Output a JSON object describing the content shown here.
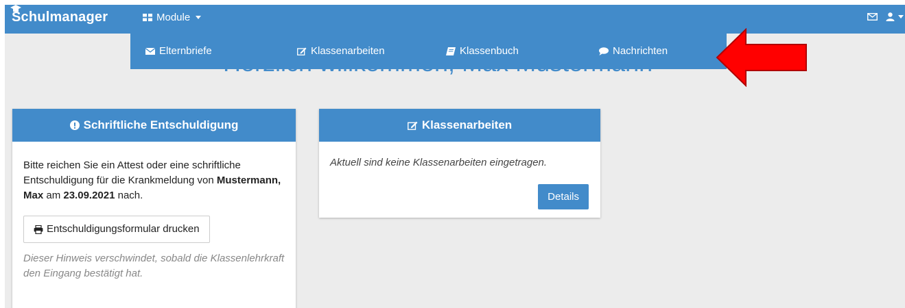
{
  "app": {
    "brand": "Schulmanager"
  },
  "navbar": {
    "module_label": "Module",
    "icons": {
      "module": "grid-icon",
      "mail": "envelope-icon",
      "user": "user-icon"
    }
  },
  "dropdown": {
    "items": [
      {
        "label": "Elternbriefe",
        "icon": "envelope-icon"
      },
      {
        "label": "Klassenarbeiten",
        "icon": "edit-icon"
      },
      {
        "label": "Klassenbuch",
        "icon": "book-icon"
      },
      {
        "label": "Nachrichten",
        "icon": "comment-icon"
      }
    ]
  },
  "welcome": "Herzlich willkommen, Max Mustermann",
  "excuse_card": {
    "title": "Schriftliche Entschuldigung",
    "text_before": "Bitte reichen Sie ein Attest oder eine schriftliche Entschuldigung für die Krankmeldung von",
    "student": "Mustermann, Max",
    "word_am": "am",
    "date": "23.09.2021",
    "word_nach": "nach.",
    "print_button": "Entschuldigungsformular drucken",
    "hint": "Dieser Hinweis verschwindet, sobald die Klassenlehrkraft den Eingang bestätigt hat."
  },
  "exams_card": {
    "title": "Klassenarbeiten",
    "text": "Aktuell sind keine Klassenarbeiten eingetragen.",
    "details_button": "Details"
  },
  "colors": {
    "primary": "#428bca",
    "background": "#ececec",
    "arrow": "#ff0000"
  }
}
